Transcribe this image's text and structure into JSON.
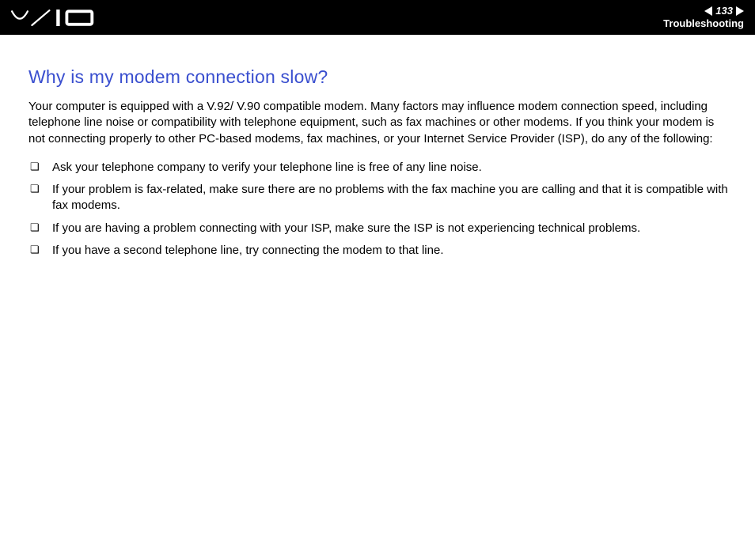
{
  "header": {
    "page_number": "133",
    "section": "Troubleshooting"
  },
  "main": {
    "heading": "Why is my modem connection slow?",
    "intro": "Your computer is equipped with a V.92/ V.90 compatible modem. Many factors may influence modem connection speed, including telephone line noise or compatibility with telephone equipment, such as fax machines or other modems. If you think your modem is not connecting properly to other PC-based modems, fax machines, or your Internet Service Provider (ISP), do any of the following:",
    "bullets": [
      "Ask your telephone company to verify your telephone line is free of any line noise.",
      "If your problem is fax-related, make sure there are no problems with the fax machine you are calling and that it is compatible with fax modems.",
      "If you are having a problem connecting with your ISP, make sure the ISP is not experiencing technical problems.",
      "If you have a second telephone line, try connecting the modem to that line."
    ]
  }
}
